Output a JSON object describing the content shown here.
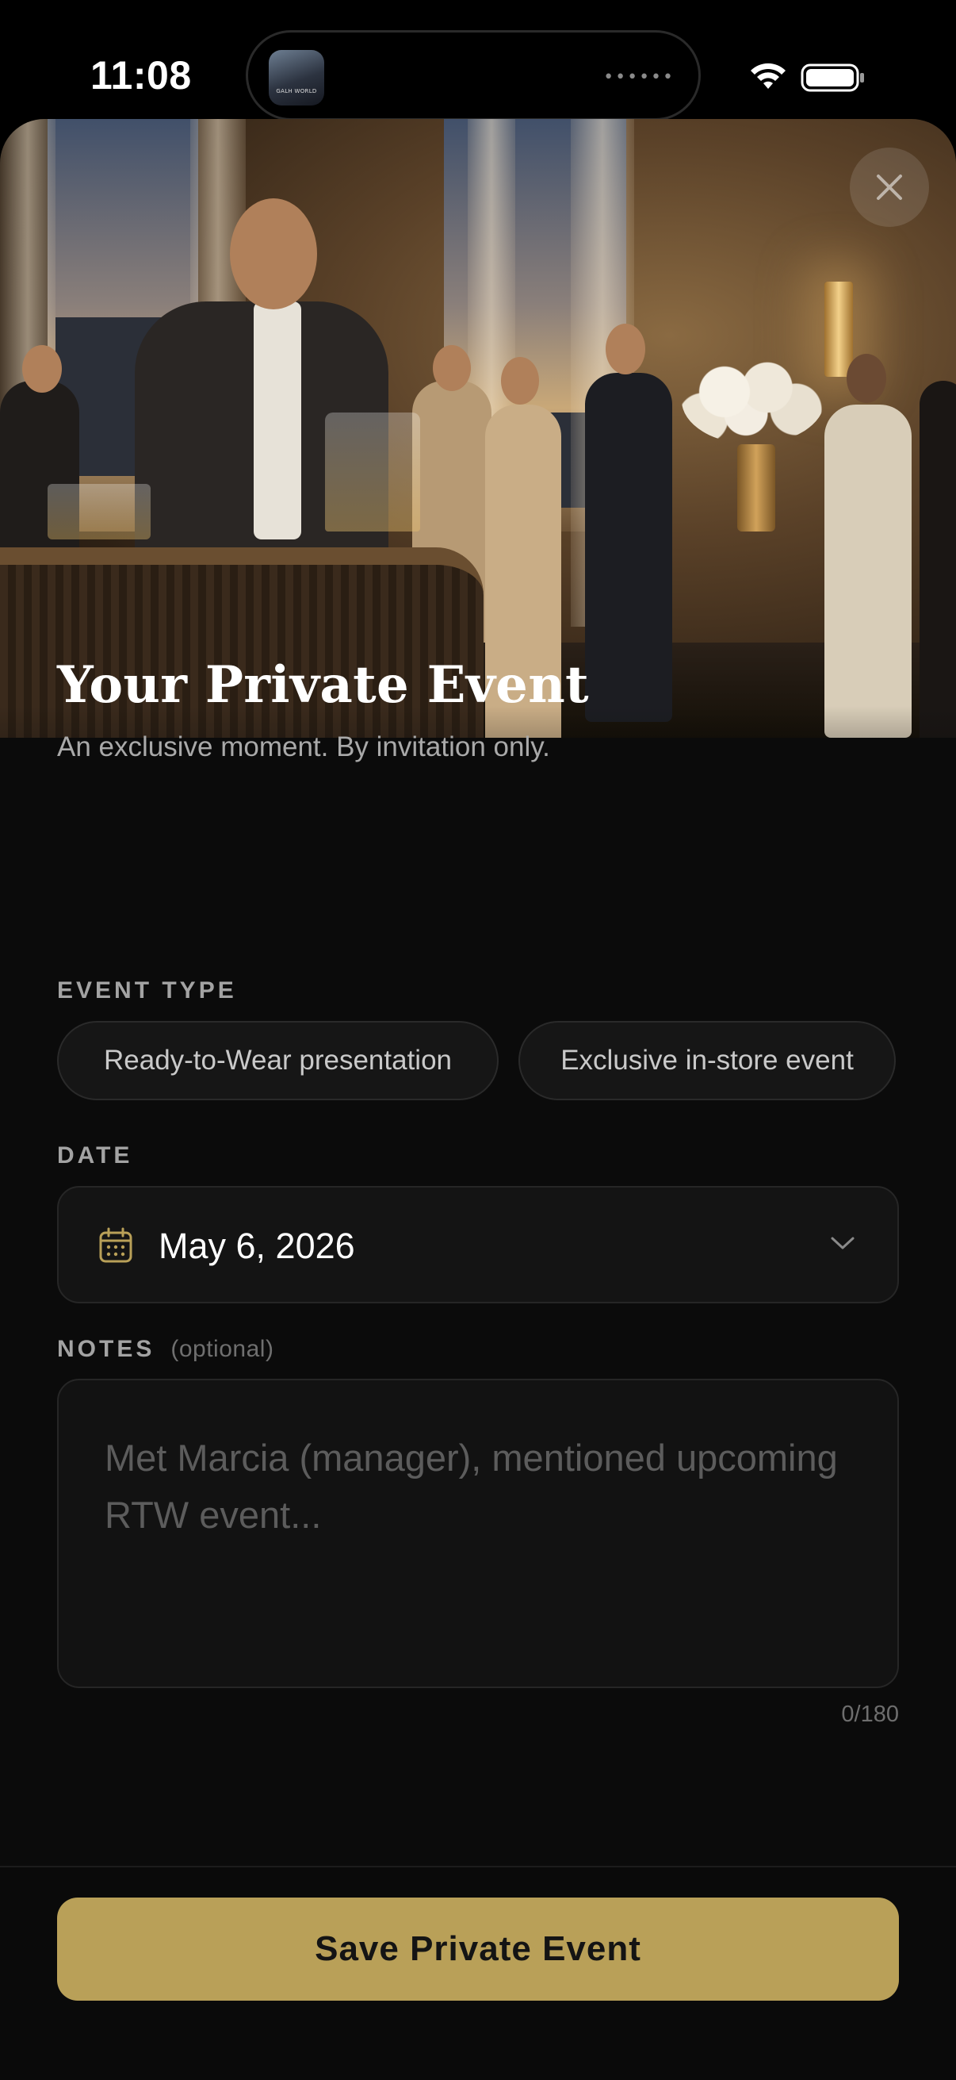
{
  "status_bar": {
    "time": "11:08",
    "island_thumbnail_text": "GALH WORLD"
  },
  "hero": {
    "description_icon": "event-photo"
  },
  "close_icon": "close-icon",
  "header": {
    "title": "Your Private Event",
    "subtitle": "An exclusive moment. By invitation only."
  },
  "event_type": {
    "label": "EVENT TYPE",
    "options": [
      "Ready-to-Wear presentation",
      "Exclusive in-store event"
    ]
  },
  "date": {
    "label": "DATE",
    "value": "May 6, 2026",
    "icon": "calendar-icon"
  },
  "notes": {
    "label": "NOTES",
    "optional_label": "(optional)",
    "placeholder": "Met Marcia (manager), mentioned upcoming RTW event...",
    "value": "",
    "char_count": "0/180"
  },
  "footer": {
    "save_label": "Save Private Event"
  },
  "colors": {
    "accent": "#b9a058",
    "background": "#0b0b0b",
    "chip_background": "#161616"
  }
}
